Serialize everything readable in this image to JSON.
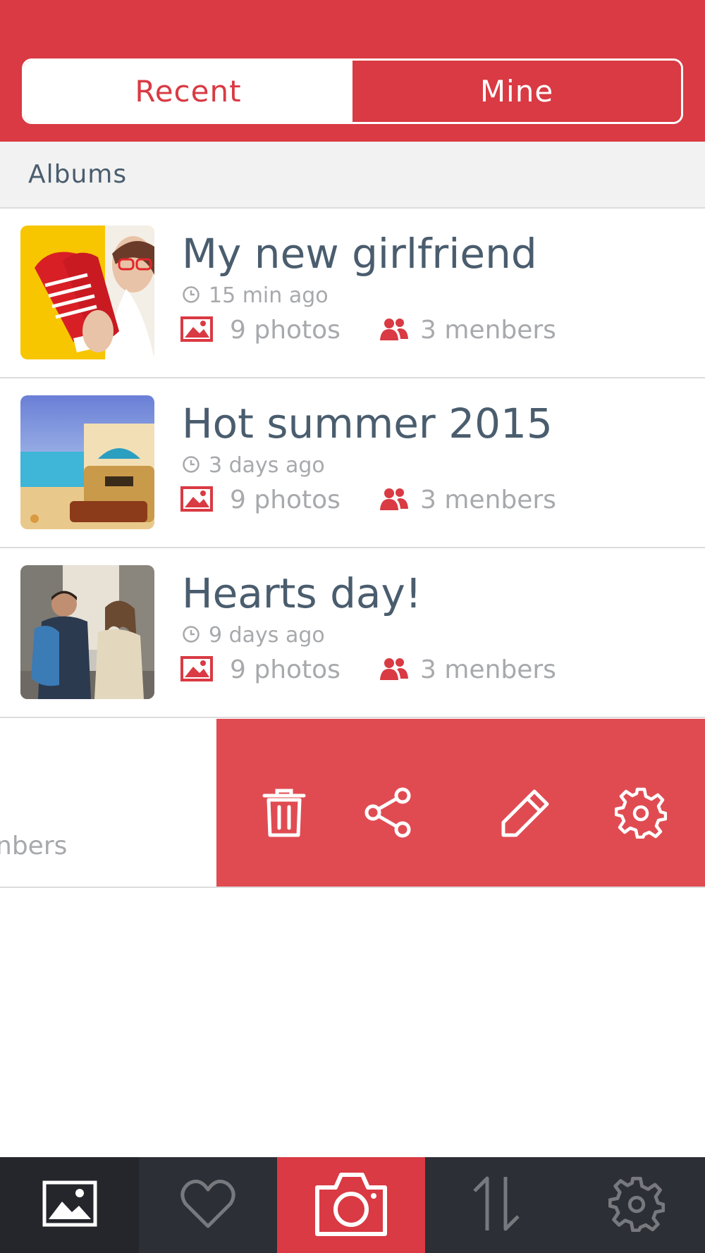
{
  "header": {
    "tabs": [
      {
        "label": "Recent",
        "active": false
      },
      {
        "label": "Mine",
        "active": true
      }
    ]
  },
  "section": {
    "title": "Albums"
  },
  "albums": [
    {
      "title": "My new girlfriend",
      "time": "15 min ago",
      "photos": "9 photos",
      "members": "3 menbers",
      "thumb": "red-sneakers-photo"
    },
    {
      "title": "Hot summer 2015",
      "time": "3 days ago",
      "photos": "9 photos",
      "members": "3 menbers",
      "thumb": "beach-suitcase-photo"
    },
    {
      "title": "Hearts day!",
      "time": "9 days ago",
      "photos": "9 photos",
      "members": "3 menbers",
      "thumb": "couple-street-photo"
    }
  ],
  "swiped_row": {
    "members_partial": "nbers",
    "actions": [
      "trash-icon",
      "share-icon",
      "pencil-icon",
      "gear-icon"
    ]
  },
  "tabbar": {
    "items": [
      "gallery-icon",
      "heart-icon",
      "camera-icon",
      "sort-arrows-icon",
      "gear-icon"
    ],
    "active": "gallery-icon"
  },
  "colors": {
    "accent": "#d93a43",
    "action_panel": "#e04b52",
    "title_text": "#4a5d6e",
    "meta_text": "#a7a9ac",
    "tabbar": "#2d2f36"
  }
}
